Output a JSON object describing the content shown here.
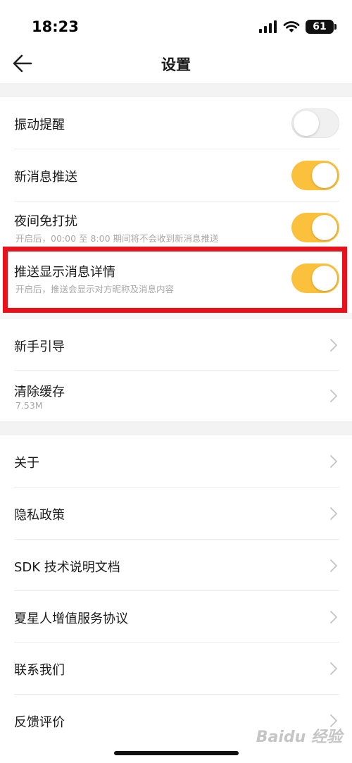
{
  "status_bar": {
    "time": "18:23",
    "battery": "61"
  },
  "nav": {
    "title": "设置"
  },
  "settings": {
    "vibrate": {
      "label": "振动提醒",
      "enabled": false
    },
    "new_msg_push": {
      "label": "新消息推送",
      "enabled": true
    },
    "night_dnd": {
      "label": "夜间免打扰",
      "sub": "开启后，00:00 至 8:00 期间将不会收到新消息推送",
      "enabled": true
    },
    "push_detail": {
      "label": "推送显示消息详情",
      "sub": "开启后，推送会显示对方昵称及消息内容",
      "enabled": true
    },
    "guide": {
      "label": "新手引导"
    },
    "cache": {
      "label": "清除缓存",
      "sub": "7.53M"
    },
    "about": {
      "label": "关于"
    },
    "privacy": {
      "label": "隐私政策"
    },
    "sdk": {
      "label": "SDK 技术说明文档"
    },
    "service": {
      "label": "夏星人增值服务协议"
    },
    "contact": {
      "label": "联系我们"
    },
    "feedback": {
      "label": "反馈评价"
    }
  },
  "colors": {
    "accent": "#fcc13c",
    "highlight": "#e8121c"
  },
  "watermark": "Baidu 经验"
}
